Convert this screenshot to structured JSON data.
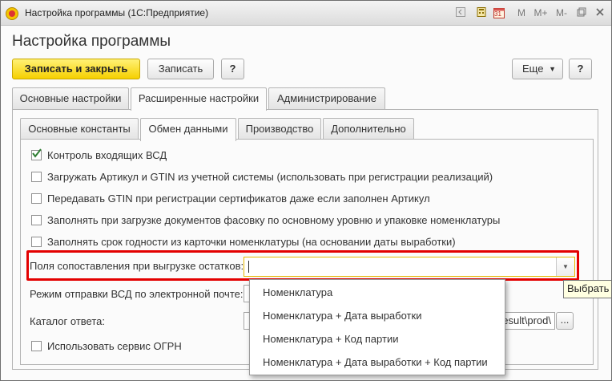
{
  "window": {
    "title": "Настройка программы (1С:Предприятие)",
    "toolbar_m": "M",
    "toolbar_mplus": "M+",
    "toolbar_mminus": "M-",
    "calendar_day": "31"
  },
  "header": {
    "title": "Настройка программы"
  },
  "toolbar": {
    "save_close_label": "Записать и закрыть",
    "save_label": "Записать",
    "help_label": "?",
    "more_label": "Еще",
    "help2_label": "?"
  },
  "tabs_top": [
    {
      "label": "Основные настройки"
    },
    {
      "label": "Расширенные настройки"
    },
    {
      "label": "Администрирование"
    }
  ],
  "tabs_inner": [
    {
      "label": "Основные константы"
    },
    {
      "label": "Обмен данными"
    },
    {
      "label": "Производство"
    },
    {
      "label": "Дополнительно"
    }
  ],
  "checkboxes": [
    {
      "label": "Контроль входящих ВСД",
      "checked": true
    },
    {
      "label": "Загружать Артикул и GTIN из учетной системы (использовать при регистрации реализаций)",
      "checked": false
    },
    {
      "label": "Передавать GTIN при регистрации сертификатов даже если заполнен Артикул",
      "checked": false
    },
    {
      "label": "Заполнять при загрузке документов фасовку по основному уровню и упаковке номенклатуры",
      "checked": false
    },
    {
      "label": "Заполнять срок годности из карточки номенклатуры (на основании даты выработки)",
      "checked": false
    }
  ],
  "fields": {
    "match_fields_label": "Поля сопоставления при выгрузке остатков:",
    "match_fields_value": "",
    "vsd_email_label": "Режим отправки ВСД по электронной почте:",
    "reply_catalog_label": "Каталог ответа:",
    "reply_catalog_value": "esult\\prod\\",
    "reply_catalog_btn": "...",
    "ogrn_label": "Использовать сервис ОГРН"
  },
  "dropdown": {
    "items": [
      "Номенклатура",
      "Номенклатура + Дата выработки",
      "Номенклатура + Код партии",
      "Номенклатура + Дата выработки + Код партии"
    ]
  },
  "tooltip": {
    "text": "Выбрать"
  },
  "colors": {
    "primary": "#f6d000",
    "highlight": "#e30000",
    "check": "#2e7d32"
  }
}
